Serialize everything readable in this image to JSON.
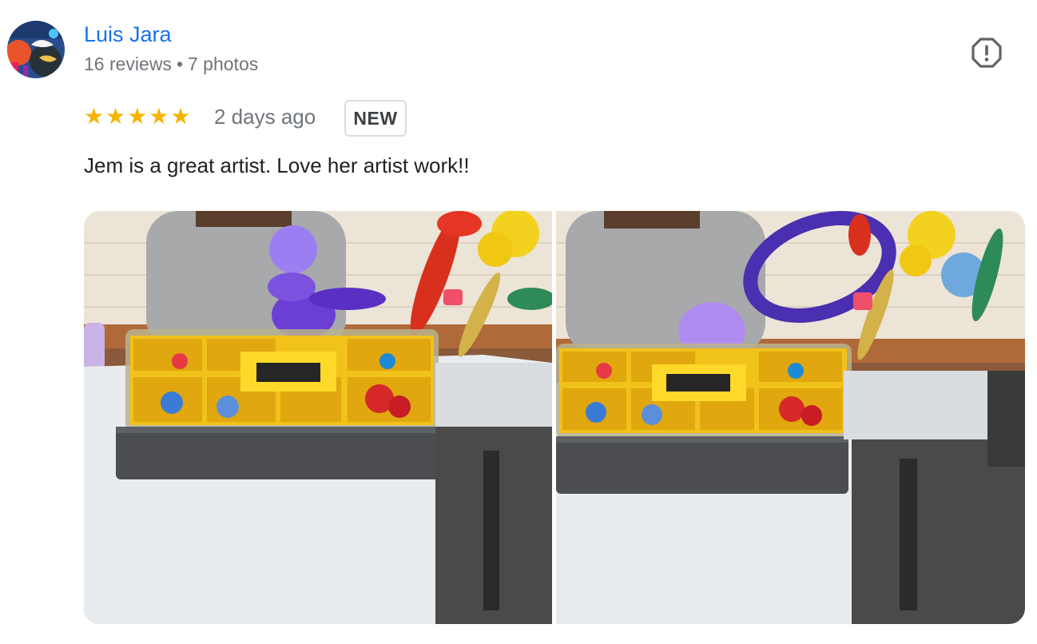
{
  "review": {
    "author": "Luis Jara",
    "reviews_count": "16 reviews",
    "separator": "•",
    "photos_count": "7 photos",
    "rating": 5,
    "time": "2 days ago",
    "badge": "NEW",
    "text": "Jem is a great artist. Love her artist work!!"
  },
  "photos": [
    {
      "alt": "Balloon artist with Stanley organizer box and balloon sculptures"
    },
    {
      "alt": "Balloon artist twisting a purple balloon over an organizer box"
    }
  ],
  "icons": {
    "report": "report-icon",
    "star": "star-icon"
  },
  "colors": {
    "link": "#1a73e8",
    "star": "#f4b400",
    "secondary_text": "#70757a"
  }
}
